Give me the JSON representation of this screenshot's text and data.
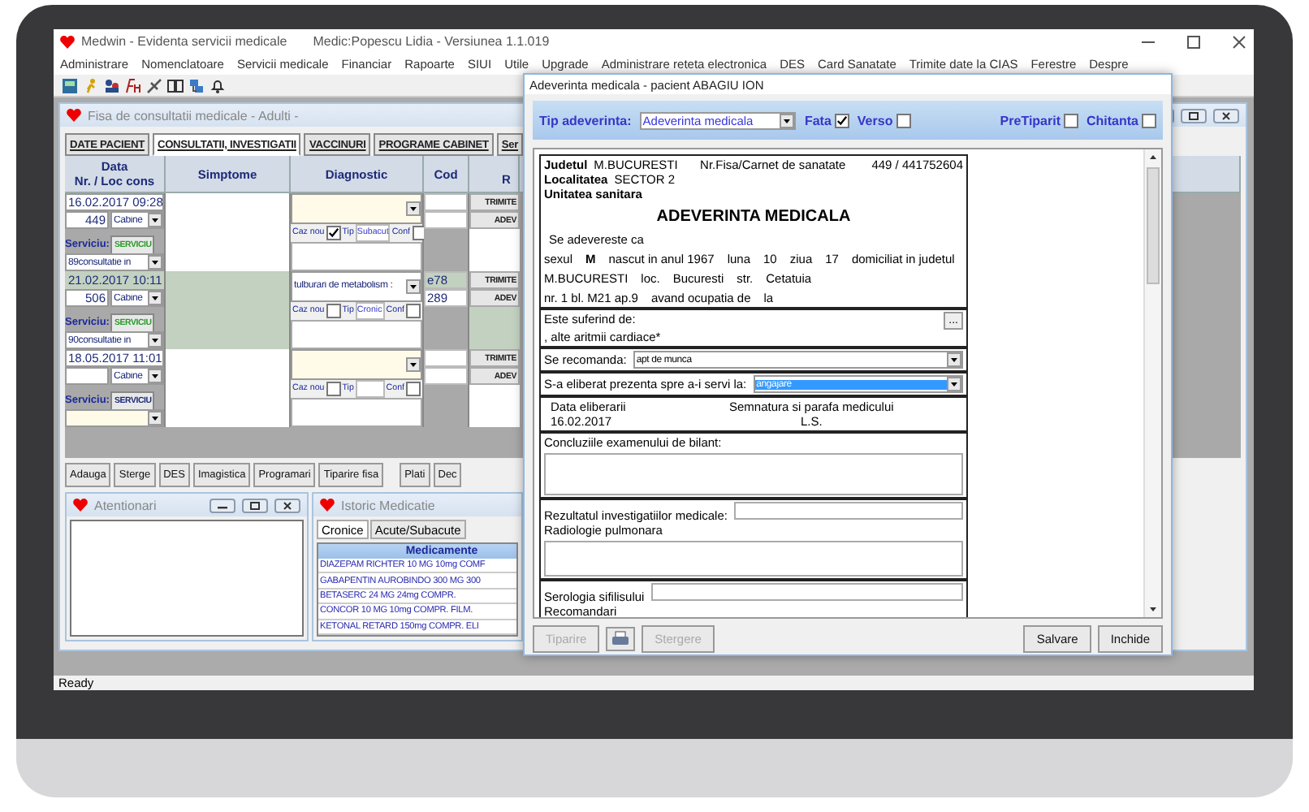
{
  "app": {
    "title": "Medwin - Evidenta servicii medicale",
    "subtitle": "Medic:Popescu Lidia - Versiunea 1.1.019"
  },
  "menu": [
    "Administrare",
    "Nomenclatoare",
    "Servicii medicale",
    "Financiar",
    "Rapoarte",
    "SIUI",
    "Utile",
    "Upgrade",
    "Administrare reteta electronica",
    "DES",
    "Card Sanatate",
    "Trimite date la CIAS",
    "Ferestre",
    "Despre"
  ],
  "fisa": {
    "title": "Fisa de consultatii medicale - Adulti -",
    "tabs": [
      {
        "label": "DATE PACIENT",
        "selected": false
      },
      {
        "label": "CONSULTATII, INVESTIGATII",
        "selected": true
      },
      {
        "label": "VACCINURI",
        "selected": false
      },
      {
        "label": "PROGRAME CABINET",
        "selected": false
      },
      {
        "label": "Ser",
        "selected": false
      }
    ],
    "columns": [
      {
        "label": "Data",
        "sublabel": "Nr. / Loc cons"
      },
      {
        "label": "Simptome"
      },
      {
        "label": "Diagnostic"
      },
      {
        "label": "Cod"
      },
      {
        "label": "R"
      }
    ],
    "rows": [
      {
        "date": "16.02.2017 09:28",
        "nr": "449",
        "loc": "Cabine",
        "service_label": "Serviciu:",
        "service_button": "SERVICIU",
        "service_set": true,
        "service": "89consultatie in",
        "caz_nou_label": "Caz nou",
        "caz_nou": true,
        "tip_label": "Tip",
        "tip": "Subacut",
        "conf_label": "Conf",
        "conf": false,
        "send": "TRIMITE",
        "adev": "ADEV",
        "highlighted": false
      },
      {
        "date": "21.02.2017 10:11",
        "nr": "506",
        "loc": "Cabine",
        "service_label": "Serviciu:",
        "service_button": "SERVICIU",
        "service_set": true,
        "service": "90consultatie in",
        "diagnostic": "tulburari de metabolism :",
        "cod": "e78",
        "cod2": "289",
        "caz_nou_label": "Caz nou",
        "caz_nou": false,
        "tip_label": "Tip",
        "tip": "Cronic",
        "conf_label": "Conf",
        "conf": false,
        "send": "TRIMITE",
        "adev": "ADEV",
        "highlighted": true
      },
      {
        "date": "18.05.2017 11:01",
        "loc": "Cabine",
        "service_label": "Serviciu:",
        "service_button": "SERVICIU",
        "service_set": false,
        "caz_nou_label": "Caz nou",
        "caz_nou": false,
        "tip_label": "Tip",
        "conf_label": "Conf",
        "conf": false,
        "send": "TRIMITE",
        "adev": "ADEV",
        "highlighted": false
      }
    ],
    "buttons": [
      "Adauga",
      "Sterge",
      "DES",
      "Imagistica",
      "Programari",
      "Tiparire fisa"
    ],
    "right_buttons": [
      "Plati",
      "Dec"
    ]
  },
  "alerts": {
    "title": "Atentionari"
  },
  "medication": {
    "title": "Istoric Medicatie",
    "tabs": [
      {
        "label": "Cronice",
        "selected": true
      },
      {
        "label": "Acute/Subacute",
        "selected": false
      }
    ],
    "column": "Medicamente",
    "rows": [
      "DIAZEPAM RICHTER 10 MG 10mg COMF",
      "GABAPENTIN AUROBINDO 300 MG 300",
      "BETASERC 24 MG 24mg COMPR.",
      "CONCOR  10 MG 10mg COMPR. FILM.",
      "KETONAL RETARD 150mg COMPR. ELI"
    ]
  },
  "dialog": {
    "title": "Adeverinta medicala - pacient ABAGIU ION",
    "type_label": "Tip adeverinta:",
    "type": "Adeverinta medicala",
    "options": [
      {
        "label": "Fata",
        "checked": true
      },
      {
        "label": "Verso",
        "checked": false
      },
      {
        "label": "PreTiparit",
        "checked": false
      },
      {
        "label": "Chitanta",
        "checked": false
      }
    ],
    "document": {
      "judet_label": "Judetul",
      "judet": "M.BUCURESTI",
      "fisa_label": "Nr.Fisa/Carnet de sanatate",
      "fisa": "449 / 441752604",
      "localitate_label": "Localitatea",
      "localitate": "SECTOR 2",
      "unitate_label": "Unitatea sanitara",
      "heading": "ADEVERINTA MEDICALA",
      "certify_label": "Se adevereste ca",
      "lines": [
        [
          {
            "text": "sexul",
            "bold": false
          },
          {
            "text": "M",
            "bold": true
          },
          {
            "text": "nascut in anul 1967",
            "bold": false
          },
          {
            "text": "luna",
            "bold": false
          },
          {
            "text": "10",
            "bold": false
          },
          {
            "text": "ziua",
            "bold": false
          },
          {
            "text": "17",
            "bold": false
          },
          {
            "text": "domiciliat in judetul",
            "bold": false
          }
        ],
        [
          {
            "text": "M.BUCURESTI",
            "bold": false
          },
          {
            "text": "loc.",
            "bold": false
          },
          {
            "text": "Bucuresti",
            "bold": false
          },
          {
            "text": "str.",
            "bold": false
          },
          {
            "text": "Cetatuia",
            "bold": false
          }
        ],
        [
          {
            "text": "nr. 1 bl. M21 ap.9",
            "bold": false
          },
          {
            "text": "avand ocupatia de",
            "bold": false
          },
          {
            "text": "la",
            "bold": false
          }
        ]
      ],
      "suffering_label": "Este suferind de:",
      "suffering": ", alte aritmii cardiace*",
      "browse": "...",
      "recommend_label": "Se recomanda:",
      "recommend": "apt de munca",
      "purpose_label": "S-a eliberat prezenta spre a-i servi la:",
      "purpose": "angajare",
      "issue_label": "Data eliberarii",
      "issue_date": "16.02.2017",
      "signature_label": "Semnatura si parafa medicului",
      "stamp": "L.S.",
      "conclusions_label": "Concluziile examenului de bilant:",
      "results_label": "Rezultatul investigatiilor medicale:",
      "results": "Radiologie pulmonara",
      "serology_label": "Serologia sifilisului",
      "recommendations_label": "Recomandari"
    },
    "left_buttons": [
      {
        "kind": "text",
        "label": "Tiparire",
        "disabled": true
      },
      {
        "kind": "print",
        "disabled": false
      },
      {
        "kind": "text",
        "label": "Stergere",
        "disabled": true
      }
    ],
    "right_buttons": [
      {
        "kind": "text",
        "label": "Salvare",
        "disabled": false
      },
      {
        "kind": "text",
        "label": "Inchide",
        "disabled": false
      }
    ]
  },
  "status_bar": "Ready"
}
